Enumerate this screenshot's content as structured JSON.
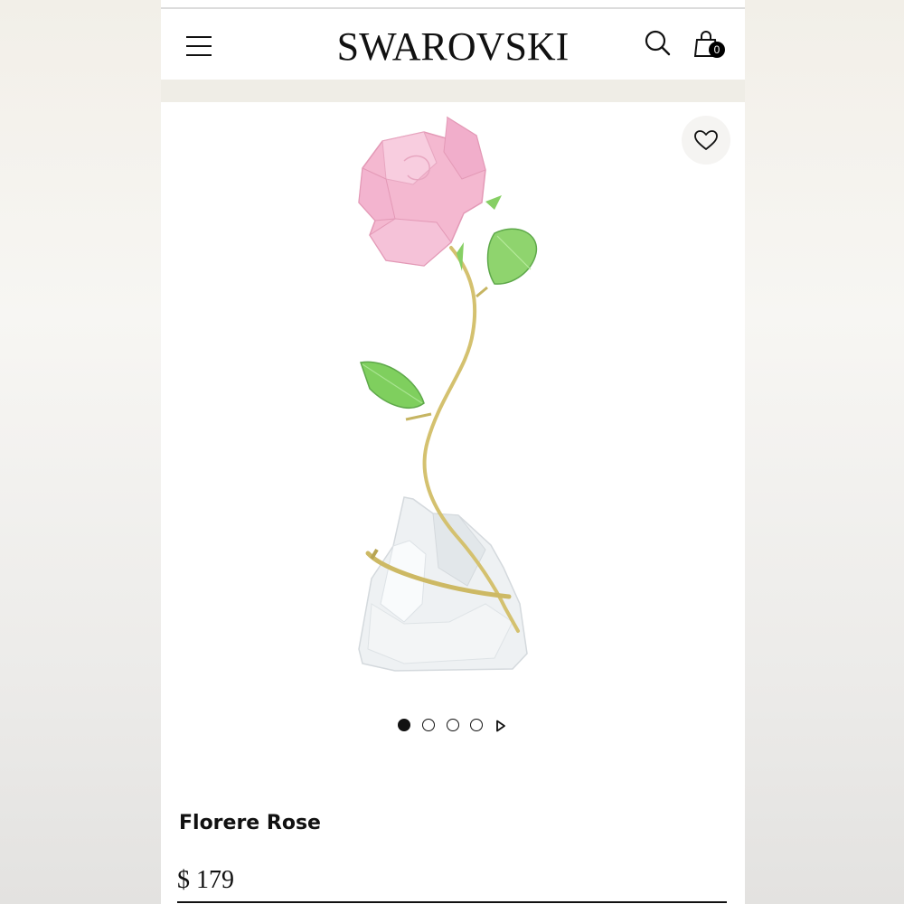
{
  "header": {
    "logo": "SWAROVSKI",
    "menu_icon": "hamburger-menu-icon",
    "search_icon": "search-icon",
    "bag_icon": "shopping-bag-icon",
    "bag_count": "0"
  },
  "product": {
    "name": "Florere Rose",
    "price": "$ 179",
    "wishlist_icon": "heart-outline-icon",
    "image_subject": "pink crystal rose figurine"
  },
  "gallery": {
    "total_images": 4,
    "active_index": 0,
    "next_icon": "play-arrow-icon"
  },
  "colors": {
    "banner": "#efede6",
    "petal": "#f4b8d0",
    "leaf": "#8fd46e",
    "stem": "#d9c878"
  }
}
